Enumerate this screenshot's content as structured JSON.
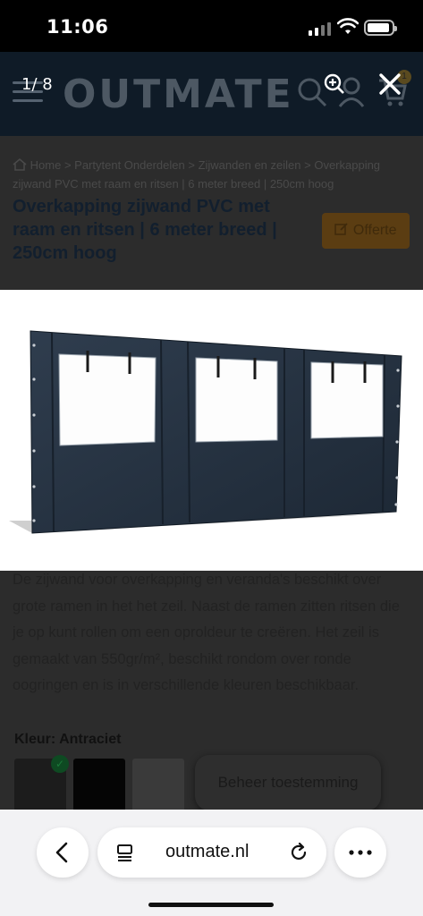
{
  "status_bar": {
    "time": "11:06"
  },
  "header": {
    "logo": "OUTMATE",
    "cart_count": "1"
  },
  "gallery": {
    "counter": "1/ 8"
  },
  "breadcrumb": {
    "home": "Home",
    "items": [
      "Partytent Onderdelen",
      "Zijwanden en zeilen",
      "Overkapping zijwand PVC met raam en ritsen | 6 meter breed | 250cm hoog"
    ],
    "separator": ">"
  },
  "product": {
    "title": "Overkapping zijwand PVC met raam en ritsen | 6 meter breed | 250cm hoog",
    "offerte_label": "Offerte",
    "description": "De zijwand voor overkapping en veranda's beschikt over grote ramen in het het zeil. Naast de ramen zitten ritsen die je op kunt rollen om een oproldeur te creëren. Het zeil is gemaakt van 550gr/m², beschikt rondom over ronde oogringen en is in verschillende kleuren beschikbaar.",
    "color_label": "Kleur:",
    "color_value": "Antraciet",
    "swatches": [
      "#1c1c1c",
      "#050505",
      "#3a3a3a"
    ]
  },
  "consent": {
    "label": "Beheer toestemming"
  },
  "browser": {
    "url": "outmate.nl"
  },
  "colors": {
    "accent": "#f0a020",
    "brand_navy": "#0f1b27"
  }
}
